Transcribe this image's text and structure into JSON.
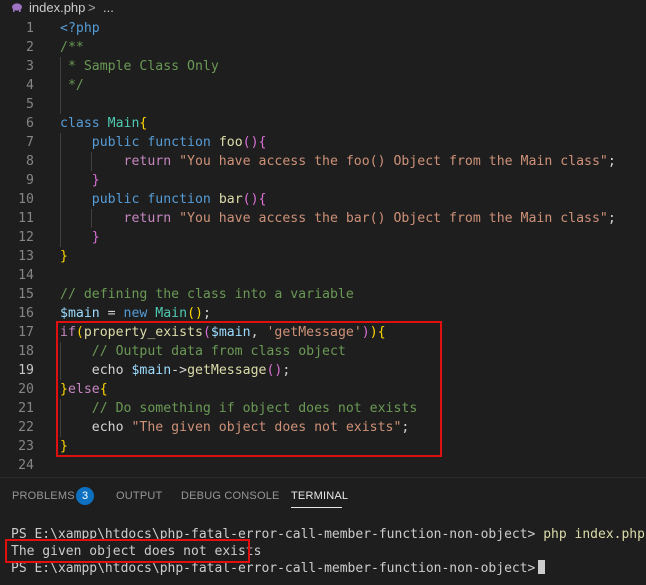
{
  "breadcrumb": {
    "file": "index.php",
    "separator": ">",
    "more": "..."
  },
  "editor": {
    "active_line": 19,
    "lines": [
      {
        "n": "1",
        "tokens": [
          [
            "tk-tag",
            "<?php"
          ]
        ]
      },
      {
        "n": "2",
        "tokens": [
          [
            "tk-cm",
            "/**"
          ]
        ]
      },
      {
        "n": "3",
        "tokens": [
          [
            "tk-cm",
            " * Sample Class Only"
          ]
        ]
      },
      {
        "n": "4",
        "tokens": [
          [
            "tk-cm",
            " */"
          ]
        ]
      },
      {
        "n": "5",
        "tokens": []
      },
      {
        "n": "6",
        "tokens": [
          [
            "tk-kw",
            "class "
          ],
          [
            "tk-cls",
            "Main"
          ],
          [
            "tk-br1",
            "{"
          ]
        ]
      },
      {
        "n": "7",
        "tokens": [
          [
            "tk-plain",
            "    "
          ],
          [
            "tk-kw",
            "public function "
          ],
          [
            "tk-fn",
            "foo"
          ],
          [
            "tk-br2",
            "(){"
          ]
        ]
      },
      {
        "n": "8",
        "tokens": [
          [
            "tk-plain",
            "        "
          ],
          [
            "tk-ctl",
            "return "
          ],
          [
            "tk-str",
            "\"You have access the foo() Object from the Main class\""
          ],
          [
            "tk-plain",
            ";"
          ]
        ]
      },
      {
        "n": "9",
        "tokens": [
          [
            "tk-plain",
            "    "
          ],
          [
            "tk-br2",
            "}"
          ]
        ]
      },
      {
        "n": "10",
        "tokens": [
          [
            "tk-plain",
            "    "
          ],
          [
            "tk-kw",
            "public function "
          ],
          [
            "tk-fn",
            "bar"
          ],
          [
            "tk-br2",
            "(){"
          ]
        ]
      },
      {
        "n": "11",
        "tokens": [
          [
            "tk-plain",
            "        "
          ],
          [
            "tk-ctl",
            "return "
          ],
          [
            "tk-str",
            "\"You have access the bar() Object from the Main class\""
          ],
          [
            "tk-plain",
            ";"
          ]
        ]
      },
      {
        "n": "12",
        "tokens": [
          [
            "tk-plain",
            "    "
          ],
          [
            "tk-br2",
            "}"
          ]
        ]
      },
      {
        "n": "13",
        "tokens": [
          [
            "tk-br1",
            "}"
          ]
        ]
      },
      {
        "n": "14",
        "tokens": []
      },
      {
        "n": "15",
        "tokens": [
          [
            "tk-cm",
            "// defining the class into a variable"
          ]
        ]
      },
      {
        "n": "16",
        "tokens": [
          [
            "tk-var",
            "$main"
          ],
          [
            "tk-plain",
            " = "
          ],
          [
            "tk-kw",
            "new "
          ],
          [
            "tk-cls",
            "Main"
          ],
          [
            "tk-br1",
            "()"
          ],
          [
            "tk-plain",
            ";"
          ]
        ]
      },
      {
        "n": "17",
        "tokens": [
          [
            "tk-ctl",
            "if"
          ],
          [
            "tk-br1",
            "("
          ],
          [
            "tk-fn",
            "property_exists"
          ],
          [
            "tk-br2",
            "("
          ],
          [
            "tk-var",
            "$main"
          ],
          [
            "tk-plain",
            ", "
          ],
          [
            "tk-str",
            "'getMessage'"
          ],
          [
            "tk-br2",
            ")"
          ],
          [
            "tk-br1",
            "){"
          ]
        ]
      },
      {
        "n": "18",
        "tokens": [
          [
            "tk-plain",
            "    "
          ],
          [
            "tk-cm",
            "// Output data from class object"
          ]
        ]
      },
      {
        "n": "19",
        "tokens": [
          [
            "tk-plain",
            "    "
          ],
          [
            "tk-plain",
            "echo "
          ],
          [
            "tk-var",
            "$main"
          ],
          [
            "tk-plain",
            "->"
          ],
          [
            "tk-fn",
            "getMessage"
          ],
          [
            "tk-br2",
            "()"
          ],
          [
            "tk-plain",
            ";"
          ]
        ]
      },
      {
        "n": "20",
        "tokens": [
          [
            "tk-br1",
            "}"
          ],
          [
            "tk-ctl",
            "else"
          ],
          [
            "tk-br1",
            "{"
          ]
        ]
      },
      {
        "n": "21",
        "tokens": [
          [
            "tk-plain",
            "    "
          ],
          [
            "tk-cm",
            "// Do something if object does not exists"
          ]
        ]
      },
      {
        "n": "22",
        "tokens": [
          [
            "tk-plain",
            "    "
          ],
          [
            "tk-plain",
            "echo "
          ],
          [
            "tk-str",
            "\"The given object does not exists\""
          ],
          [
            "tk-plain",
            ";"
          ]
        ]
      },
      {
        "n": "23",
        "tokens": [
          [
            "tk-br1",
            "}"
          ]
        ]
      },
      {
        "n": "24",
        "tokens": []
      }
    ]
  },
  "panel": {
    "tabs": [
      {
        "label": "PROBLEMS",
        "active": false
      },
      {
        "label": "OUTPUT",
        "active": false
      },
      {
        "label": "DEBUG CONSOLE",
        "active": false
      },
      {
        "label": "TERMINAL",
        "active": true
      }
    ],
    "problems_count": "3",
    "terminal": {
      "prompt1": "PS E:\\xampp\\htdocs\\php-fatal-error-call-member-function-non-object> ",
      "command": "php index.php",
      "output": "The given object does not exists",
      "prompt2": "PS E:\\xampp\\htdocs\\php-fatal-error-call-member-function-non-object>"
    }
  },
  "colors": {
    "highlight_border": "#e01010",
    "badge": "#0e70c0",
    "background": "#1e1e1e"
  },
  "icons": {
    "file_icon": "php-elephant-icon"
  }
}
